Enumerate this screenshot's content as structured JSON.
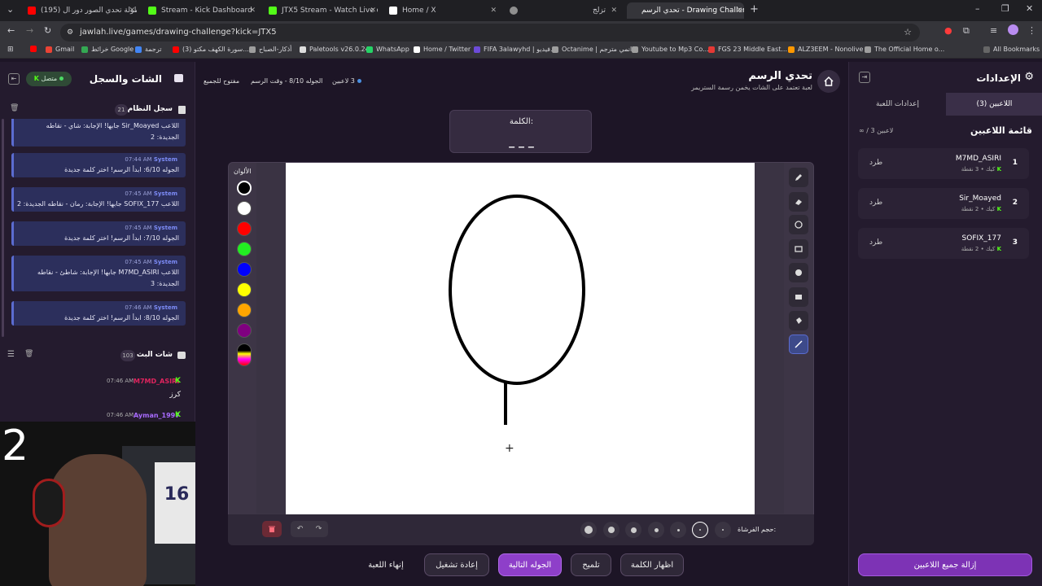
{
  "browser": {
    "tabs": [
      {
        "label": "(195) بطولة تحدي الصور دور ال",
        "color": "#ff0000"
      },
      {
        "label": "Stream - Kick Dashboard",
        "color": "#53fc18"
      },
      {
        "label": "JTX5 Stream - Watch Live on Ki",
        "color": "#53fc18"
      },
      {
        "label": "Home / X",
        "color": "#ffffff"
      },
      {
        "label": "",
        "color": "#8f8f8f"
      },
      {
        "label": "تزلج",
        "color": "#8f8f8f"
      },
      {
        "label": "تحدي الرسم - Drawing Challenge",
        "color": "#8f8f8f"
      }
    ],
    "url": "jawlah.live/games/drawing-challenge?kick=JTX5",
    "bookmarks": [
      "Gmail",
      "خرائط Google",
      "ترجمة",
      "(3) سورة الكهف مكتو...",
      "أذكار-الصباح",
      "Paletools v26.0.24",
      "WhatsApp",
      "Home / Twitter",
      "FIFA 3alawyhd | فيديو...",
      "Octanime | انمي مترجم...",
      "Youtube to Mp3 Co...",
      "FGS 23 Middle East...",
      "ALZ3EEM - Nonolive",
      "The Official Home o...",
      "All Bookmarks"
    ]
  },
  "left": {
    "title": "الشات والسجل",
    "status": "متصل",
    "system_log_title": "سجل النظام",
    "system_log_count": "21",
    "messages": [
      {
        "time": "",
        "body": "اللاعب Sir_Moayed جابها! الإجابة: شاي - نقاطه الجديدة: 2"
      },
      {
        "time": "07:44 AM",
        "body": "الجوله 6/10: ابدأ الرسم! اختر كلمة جديدة"
      },
      {
        "time": "07:45 AM",
        "body": "اللاعب SOFIX_177 جابها! الإجابة: رمان - نقاطه الجديدة: 2"
      },
      {
        "time": "07:45 AM",
        "body": "الجوله 7/10: ابدأ الرسم! اختر كلمة جديدة"
      },
      {
        "time": "07:45 AM",
        "body": "اللاعب M7MD_ASIRI جابها! الإجابة: شاطئ - نقاطه الجديدة: 3"
      },
      {
        "time": "07:46 AM",
        "body": "الجوله 8/10: ابدأ الرسم! اختر كلمة جديدة"
      }
    ],
    "system_sender": "System",
    "stream_chat_title": "شات البث",
    "stream_chat_count": "103",
    "chat": [
      {
        "user": "M7MD_ASIRI",
        "time": "07:46 AM",
        "text": "كرز",
        "color": "#e0245e"
      },
      {
        "user": "Ayman_1997",
        "time": "07:46 AM",
        "text": "",
        "color": "#a86bff"
      }
    ],
    "webcam_number": "2"
  },
  "center": {
    "game_title": "تحدي الرسم",
    "game_subtitle": "لعبة تعتمد على الشات يخمن رسمة الستريمر",
    "players_badge": "3 لاعبين",
    "round_info": "الجوله 8/10 - وقت الرسم",
    "open_info": "مفتوح للجميع",
    "word_label": "الكلمة:",
    "word_mask": "_ _ _",
    "colors_label": "الألوان",
    "colors": [
      "#000000",
      "#ffffff",
      "#ff0000",
      "#22ee22",
      "#0000ff",
      "#ffff00",
      "#ffa500",
      "#800080"
    ],
    "brush_label": "حجم الفرشاة:",
    "buttons": {
      "end_game": "إنهاء اللعبة",
      "restart": "إعادة تشغيل",
      "next_round": "الجوله التالية",
      "hint": "تلميح",
      "reveal_word": "اظهار الكلمة"
    }
  },
  "right": {
    "title": "الإعدادات",
    "tab_players": "اللاعبين (3)",
    "tab_game_settings": "إعدادات اللعبة",
    "players_list_title": "قائمة اللاعبين",
    "players_count": "∞ / 3 لاعبين",
    "kick_label": "طرد",
    "platform": "كيك",
    "players": [
      {
        "rank": "1",
        "name": "M7MD_ASIRI",
        "points": "3 نقطة"
      },
      {
        "rank": "2",
        "name": "Sir_Moayed",
        "points": "2 نقطة"
      },
      {
        "rank": "3",
        "name": "SOFIX_177",
        "points": "2 نقطة"
      }
    ],
    "remove_all": "إزالة جميع اللاعبين"
  }
}
